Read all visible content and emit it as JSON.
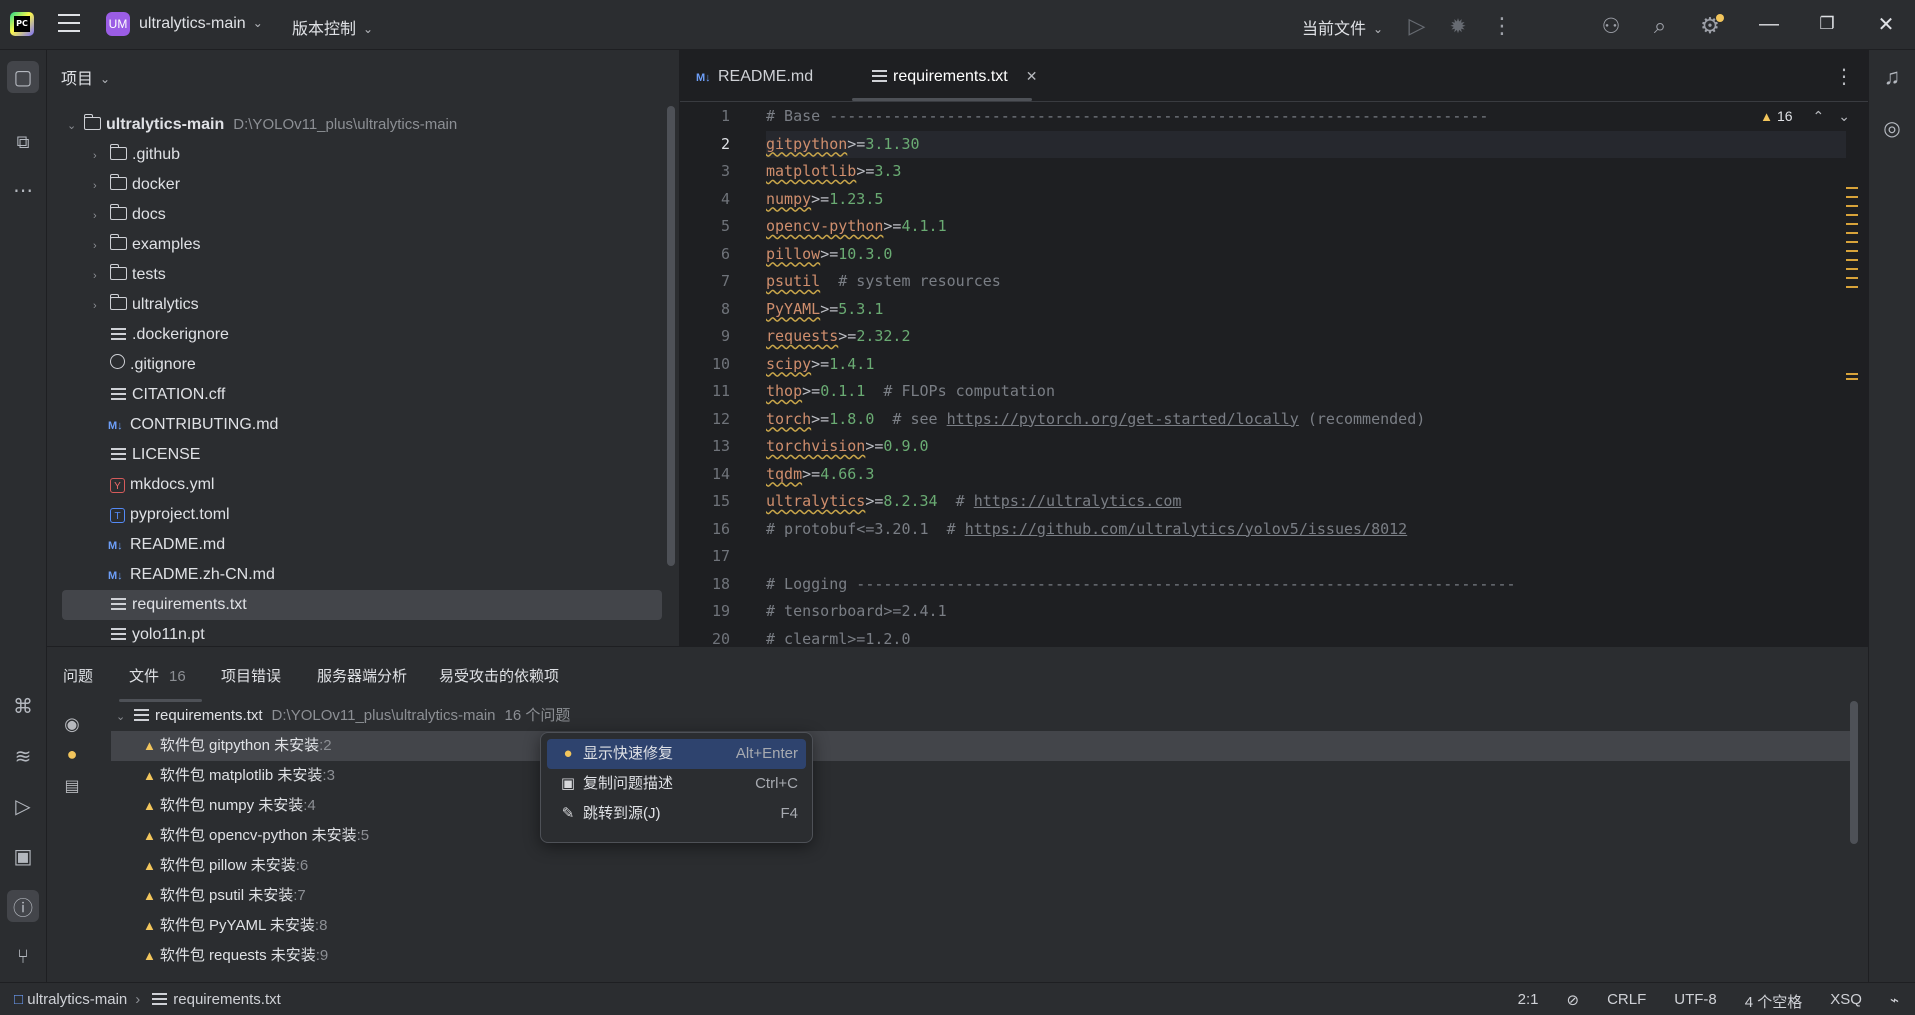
{
  "domain_ui": "IDE",
  "title_bar": {
    "project_badge": "UM",
    "project_name": "ultralytics-main",
    "vcs_label": "版本控制",
    "run_config": "当前文件"
  },
  "project_panel": {
    "header": "项目",
    "root": {
      "name": "ultralytics-main",
      "path": "D:\\YOLOv11_plus\\ultralytics-main"
    },
    "items": [
      {
        "name": ".github",
        "type": "folder"
      },
      {
        "name": "docker",
        "type": "folder"
      },
      {
        "name": "docs",
        "type": "folder"
      },
      {
        "name": "examples",
        "type": "folder"
      },
      {
        "name": "tests",
        "type": "folder"
      },
      {
        "name": "ultralytics",
        "type": "folder"
      },
      {
        "name": ".dockerignore",
        "type": "file"
      },
      {
        "name": ".gitignore",
        "type": "ignore"
      },
      {
        "name": "CITATION.cff",
        "type": "file"
      },
      {
        "name": "CONTRIBUTING.md",
        "type": "md"
      },
      {
        "name": "LICENSE",
        "type": "file"
      },
      {
        "name": "mkdocs.yml",
        "type": "yml"
      },
      {
        "name": "pyproject.toml",
        "type": "toml"
      },
      {
        "name": "README.md",
        "type": "md"
      },
      {
        "name": "README.zh-CN.md",
        "type": "md"
      },
      {
        "name": "requirements.txt",
        "type": "file"
      },
      {
        "name": "yolo11n.pt",
        "type": "file"
      }
    ]
  },
  "editor": {
    "tabs": [
      {
        "label": "README.md"
      },
      {
        "label": "requirements.txt",
        "active": true
      }
    ],
    "inspection_count": "16",
    "line_numbers": [
      "1",
      "2",
      "3",
      "4",
      "5",
      "6",
      "7",
      "8",
      "9",
      "10",
      "11",
      "12",
      "13",
      "14",
      "15",
      "16",
      "17",
      "18",
      "19",
      "20"
    ],
    "lines": {
      "l1": "# Base -------------------------------------------------------------------------",
      "l2_pkg": "gitpython",
      "l2_op": ">=",
      "l2_ver": "3.1.30",
      "l3_pkg": "matplotlib",
      "l3_op": ">=",
      "l3_ver": "3.3",
      "l4_pkg": "numpy",
      "l4_op": ">=",
      "l4_ver": "1.23.5",
      "l5_pkg": "opencv-python",
      "l5_op": ">=",
      "l5_ver": "4.1.1",
      "l6_pkg": "pillow",
      "l6_op": ">=",
      "l6_ver": "10.3.0",
      "l7_pkg": "psutil",
      "l7_comment": "  # system resources",
      "l8_pkg": "PyYAML",
      "l8_op": ">=",
      "l8_ver": "5.3.1",
      "l9_pkg": "requests",
      "l9_op": ">=",
      "l9_ver": "2.32.2",
      "l10_pkg": "scipy",
      "l10_op": ">=",
      "l10_ver": "1.4.1",
      "l11_pkg": "thop",
      "l11_op": ">=",
      "l11_ver": "0.1.1",
      "l11_comment": "  # FLOPs computation",
      "l12_pkg": "torch",
      "l12_op": ">=",
      "l12_ver": "1.8.0",
      "l12_comment": "  # see ",
      "l12_link": "https://pytorch.org/get-started/locally",
      "l12_tail": " (recommended)",
      "l13_pkg": "torchvision",
      "l13_op": ">=",
      "l13_ver": "0.9.0",
      "l14_pkg": "tqdm",
      "l14_op": ">=",
      "l14_ver": "4.66.3",
      "l15_pkg": "ultralytics",
      "l15_op": ">=",
      "l15_ver": "8.2.34",
      "l15_comment": "  # ",
      "l15_link": "https://ultralytics.com",
      "l16_comment": "# protobuf<=3.20.1  # ",
      "l16_link": "https://github.com/ultralytics/yolov5/issues/8012",
      "l17": "",
      "l18": "# Logging -------------------------------------------------------------------------",
      "l19": "# tensorboard>=2.4.1",
      "l20": "# clearml>=1.2.0"
    }
  },
  "problems": {
    "tabs": {
      "problems": "问题",
      "file": "文件",
      "file_count": "16",
      "project_errors": "项目错误",
      "server_analysis": "服务器端分析",
      "vulnerable": "易受攻击的依赖项"
    },
    "file_header": {
      "name": "requirements.txt",
      "path": "D:\\YOLOv11_plus\\ultralytics-main",
      "summary": "16 个问题"
    },
    "rows": [
      {
        "text": "软件包 gitpython 未安装",
        "line": ":2"
      },
      {
        "text": "软件包 matplotlib 未安装",
        "line": ":3"
      },
      {
        "text": "软件包 numpy 未安装",
        "line": ":4"
      },
      {
        "text": "软件包 opencv-python 未安装",
        "line": ":5"
      },
      {
        "text": "软件包 pillow 未安装",
        "line": ":6"
      },
      {
        "text": "软件包 psutil 未安装",
        "line": ":7"
      },
      {
        "text": "软件包 PyYAML 未安装",
        "line": ":8"
      },
      {
        "text": "软件包 requests 未安装",
        "line": ":9"
      }
    ]
  },
  "context_menu": {
    "items": [
      {
        "label": "显示快速修复",
        "shortcut": "Alt+Enter"
      },
      {
        "label": "复制问题描述",
        "shortcut": "Ctrl+C"
      },
      {
        "label": "跳转到源(J)",
        "shortcut": "F4"
      }
    ]
  },
  "status_bar": {
    "project": "ultralytics-main",
    "file": "requirements.txt",
    "position": "2:1",
    "line_endings": "CRLF",
    "encoding": "UTF-8",
    "indent": "4 个空格",
    "interpreter": "XSQ"
  },
  "colors": {
    "accent": "#3574f0",
    "warning": "#f2c55c",
    "string": "#6aab73",
    "keyword": "#cf8e6d"
  }
}
